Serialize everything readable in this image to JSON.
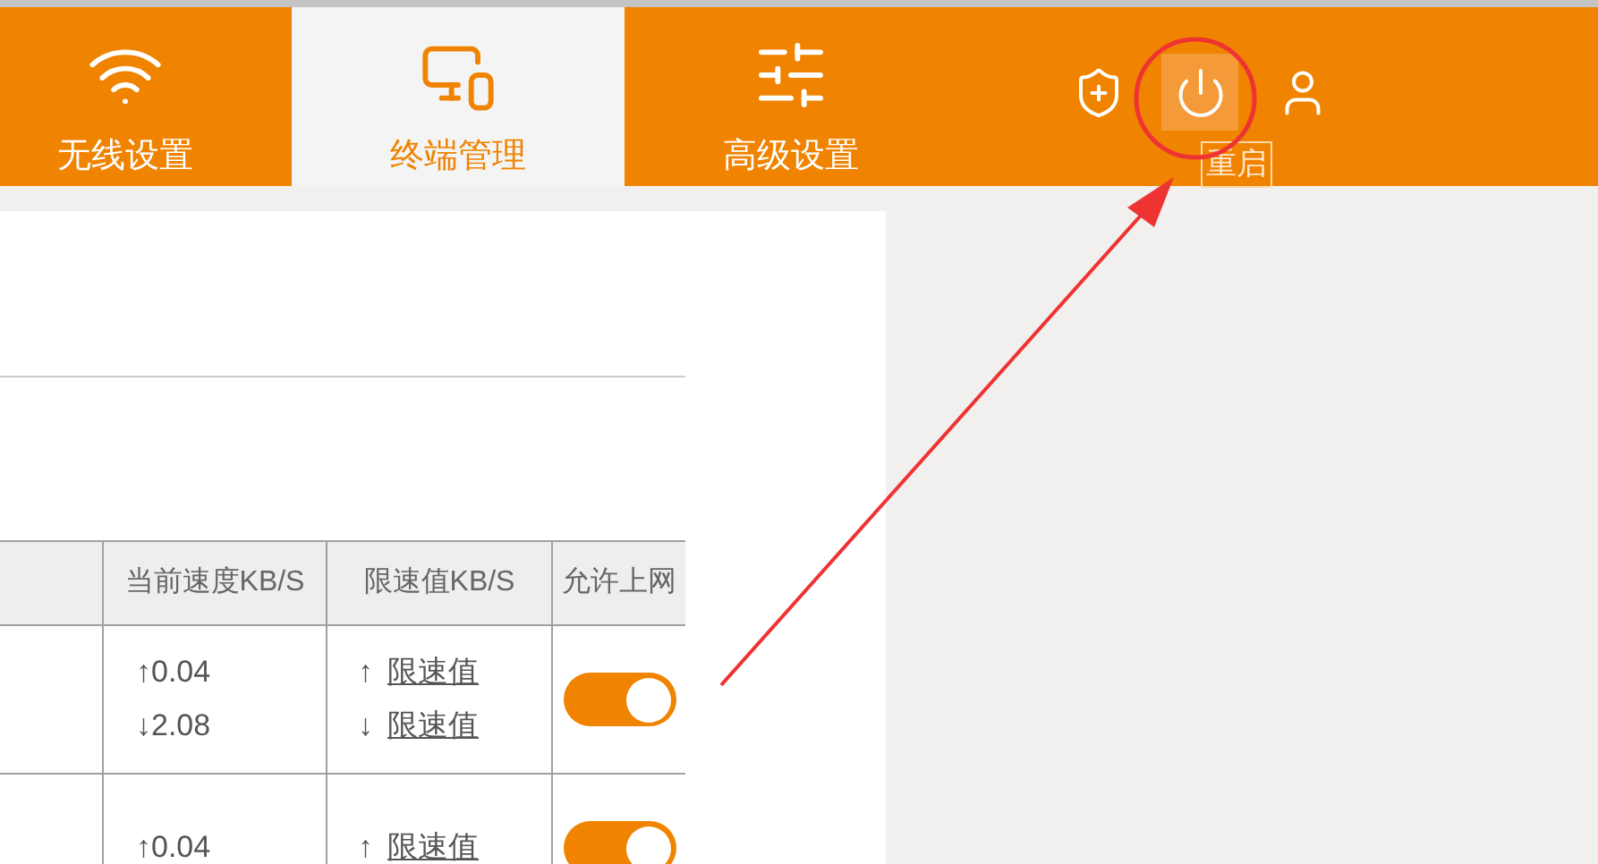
{
  "nav": {
    "tabs": [
      {
        "label": "无线设置",
        "kind": "wifi",
        "selected": false
      },
      {
        "label": "终端管理",
        "kind": "devices",
        "selected": true
      },
      {
        "label": "高级设置",
        "kind": "sliders",
        "selected": false
      }
    ]
  },
  "actions": [
    {
      "kind": "shield",
      "hovered": false
    },
    {
      "kind": "power",
      "hovered": true,
      "tooltip": "重启"
    },
    {
      "kind": "user",
      "hovered": false
    }
  ],
  "table": {
    "columns": [
      "当前速度KB/S",
      "限速值KB/S",
      "允许上网"
    ],
    "rows": [
      {
        "speed_up": "↑0.04",
        "speed_down": "↓2.08",
        "limit_up_arrow": "↑",
        "limit_up": "限速值",
        "limit_down_arrow": "↓",
        "limit_down": "限速值",
        "allowed": true
      },
      {
        "speed_up": "↑0.04",
        "limit_up_arrow": "↑",
        "limit_up": "限速值",
        "allowed": true
      }
    ]
  }
}
